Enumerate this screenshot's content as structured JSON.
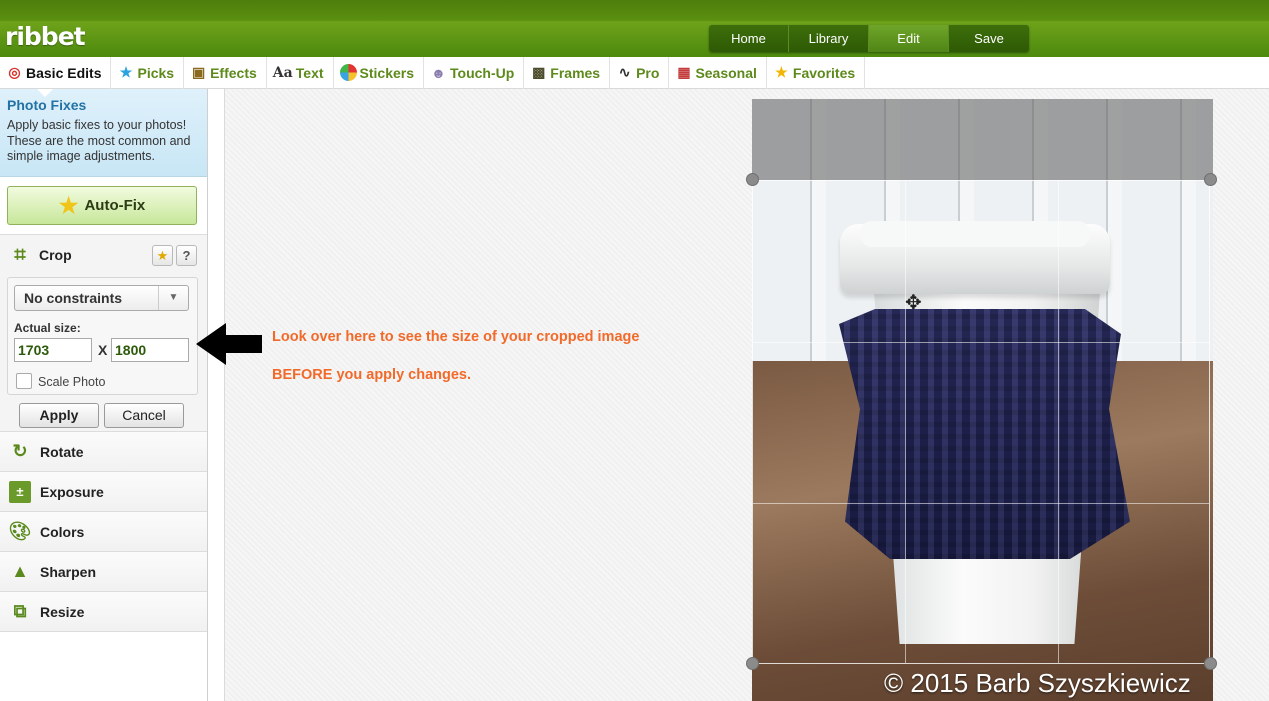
{
  "app": {
    "logo": "ribbet"
  },
  "main_nav": [
    {
      "label": "Home",
      "active": false
    },
    {
      "label": "Library",
      "active": false
    },
    {
      "label": "Edit",
      "active": true
    },
    {
      "label": "Save",
      "active": false
    }
  ],
  "tabs": [
    {
      "label": "Basic Edits",
      "icon": "lifebuoy-icon",
      "active": true
    },
    {
      "label": "Picks",
      "icon": "star-icon",
      "active": false
    },
    {
      "label": "Effects",
      "icon": "film-icon",
      "active": false
    },
    {
      "label": "Text",
      "icon": "text-icon",
      "active": false
    },
    {
      "label": "Stickers",
      "icon": "beachball-icon",
      "active": false
    },
    {
      "label": "Touch-Up",
      "icon": "person-icon",
      "active": false
    },
    {
      "label": "Frames",
      "icon": "picture-frame-icon",
      "active": false
    },
    {
      "label": "Pro",
      "icon": "curve-icon",
      "active": false
    },
    {
      "label": "Seasonal",
      "icon": "calendar-icon",
      "active": false
    },
    {
      "label": "Favorites",
      "icon": "star-icon",
      "active": false
    }
  ],
  "sidebar": {
    "photo_fixes": {
      "title": "Photo Fixes",
      "description": "Apply basic fixes to your photos! These are the most common and simple image adjustments."
    },
    "autofix_label": "Auto-Fix",
    "crop": {
      "label": "Crop",
      "constraint": "No constraints",
      "actual_size_label": "Actual size:",
      "width": "1703",
      "height": "1800",
      "x_sep": "X",
      "scale_label": "Scale Photo",
      "scale_checked": false,
      "apply_label": "Apply",
      "cancel_label": "Cancel",
      "fav_glyph": "★",
      "help_glyph": "?"
    },
    "sections": [
      {
        "label": "Rotate",
        "icon": "rotate-icon"
      },
      {
        "label": "Exposure",
        "icon": "exposure-icon"
      },
      {
        "label": "Colors",
        "icon": "palette-icon"
      },
      {
        "label": "Sharpen",
        "icon": "sharpen-icon"
      },
      {
        "label": "Resize",
        "icon": "resize-icon"
      }
    ]
  },
  "annotation": {
    "line1": "Look over here to see the size of your cropped image",
    "line2": "BEFORE you apply changes."
  },
  "photo": {
    "watermark": "© 2015 Barb Szyszkiewicz"
  },
  "colors": {
    "brand_green": "#5a8f10",
    "tab_text": "#5d8a1b",
    "annotation": "#f26a2a",
    "fixes_title": "#2272a6"
  }
}
